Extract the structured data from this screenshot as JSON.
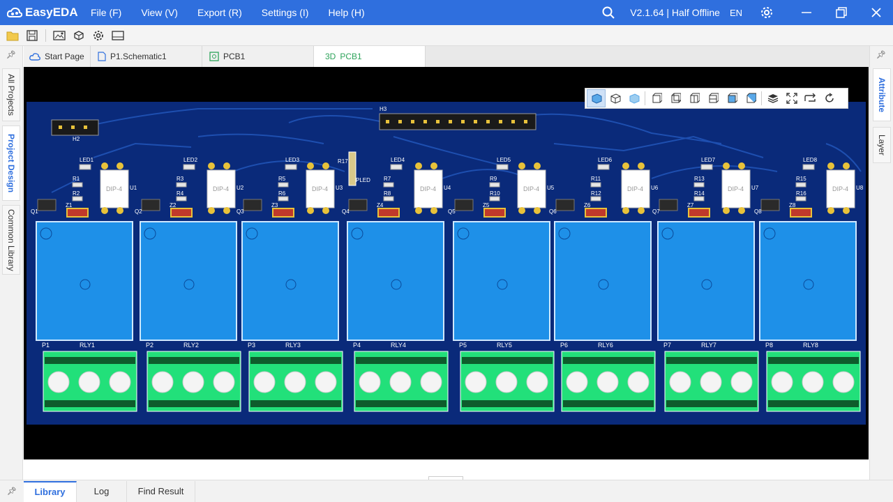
{
  "app": {
    "name": "EasyEDA",
    "version_text": "V2.1.64 | Half Offline",
    "language": "EN"
  },
  "menu": [
    "File (F)",
    "View (V)",
    "Export (R)",
    "Settings (I)",
    "Help (H)"
  ],
  "left_panel": {
    "tabs": [
      "All Projects",
      "Project Design",
      "Common Library"
    ],
    "active": "Project Design"
  },
  "right_panel": {
    "tabs": [
      "Attribute",
      "Layer"
    ],
    "active": "Attribute"
  },
  "tabs": [
    {
      "label": "Start Page",
      "icon": "cloud-icon"
    },
    {
      "label": "P1.Schematic1",
      "icon": "schematic-file-icon"
    },
    {
      "label": "PCB1",
      "icon": "pcb-file-icon"
    },
    {
      "label": "PCB1",
      "prefix": "3D",
      "icon": "3d-icon"
    }
  ],
  "active_tab": "3D PCB1",
  "bottom_panel": {
    "tabs": [
      "Library",
      "Log",
      "Find Result"
    ],
    "active": "Library"
  },
  "pcb": {
    "headers": [
      "H2",
      "H3"
    ],
    "channels": [
      {
        "relay": "RLY1",
        "terminal": "P1",
        "transistor": "Q1",
        "zener": "Z1",
        "optocoupler": "U1",
        "led": "LED1",
        "resistors": [
          "R1",
          "R2"
        ]
      },
      {
        "relay": "RLY2",
        "terminal": "P2",
        "transistor": "Q2",
        "zener": "Z2",
        "optocoupler": "U2",
        "led": "LED2",
        "resistors": [
          "R3",
          "R4"
        ]
      },
      {
        "relay": "RLY3",
        "terminal": "P3",
        "transistor": "Q3",
        "zener": "Z3",
        "optocoupler": "U3",
        "led": "LED3",
        "resistors": [
          "R5",
          "R6"
        ]
      },
      {
        "relay": "RLY4",
        "terminal": "P4",
        "transistor": "Q4",
        "zener": "Z4",
        "optocoupler": "U4",
        "led": "LED4",
        "resistors": [
          "R7",
          "R8"
        ]
      },
      {
        "relay": "RLY5",
        "terminal": "P5",
        "transistor": "Q5",
        "zener": "Z5",
        "optocoupler": "U5",
        "led": "LED5",
        "resistors": [
          "R9",
          "R10"
        ]
      },
      {
        "relay": "RLY6",
        "terminal": "P6",
        "transistor": "Q6",
        "zener": "Z6",
        "optocoupler": "U6",
        "led": "LED6",
        "resistors": [
          "R11",
          "R12"
        ]
      },
      {
        "relay": "RLY7",
        "terminal": "P7",
        "transistor": "Q7",
        "zener": "Z7",
        "optocoupler": "U7",
        "led": "LED7",
        "resistors": [
          "R13",
          "R14"
        ]
      },
      {
        "relay": "RLY8",
        "terminal": "P8",
        "transistor": "Q8",
        "zener": "Z8",
        "optocoupler": "U8",
        "led": "LED8",
        "resistors": [
          "R15",
          "R16"
        ]
      }
    ],
    "extra_parts": [
      "R17",
      "PLED"
    ],
    "opto_marking": "DIP-4"
  },
  "colors": {
    "titlebar": "#2f6fde",
    "board": "#0a2a7a",
    "trace": "#1e4fb0",
    "relay": "#1e90e8",
    "terminal": "#22e07a",
    "canvas_bg": "#000000"
  }
}
